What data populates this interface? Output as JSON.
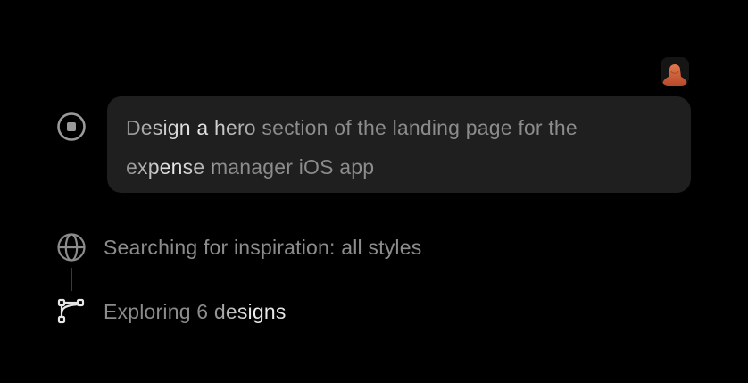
{
  "user_message": {
    "line1": "Design a hero section of the landing page for the",
    "line2": "expense manager iOS app"
  },
  "steps": {
    "search": {
      "icon": "globe-icon",
      "label": "Searching for inspiration: all styles"
    },
    "explore": {
      "icon": "branch-icon",
      "label": "Exploring 6 designs"
    }
  },
  "controls": {
    "stop_icon": "stop-icon"
  },
  "avatar": {
    "icon": "user-avatar"
  },
  "colors": {
    "background": "#000000",
    "bubble": "#1f1f1f",
    "text_muted": "#8c8c8c",
    "text_bright": "#ececec",
    "avatar_accent": "#d2613a"
  }
}
